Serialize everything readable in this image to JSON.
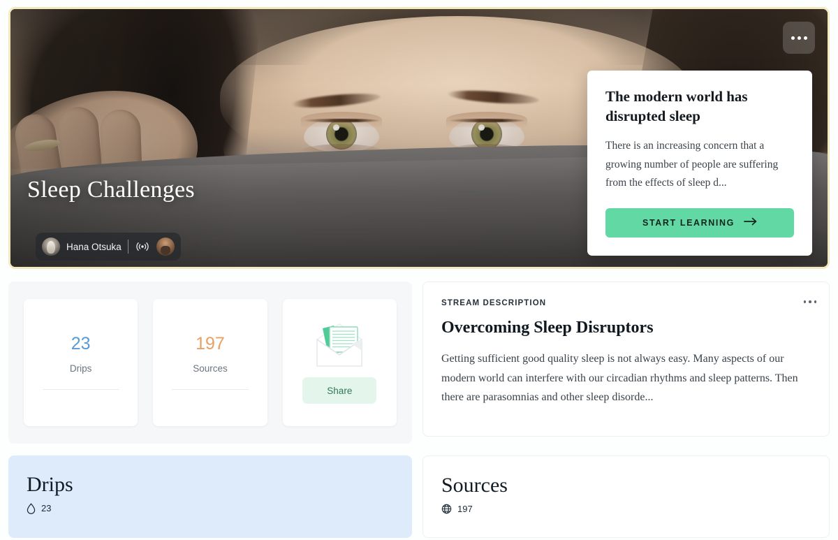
{
  "hero": {
    "title": "Sleep Challenges",
    "author_name": "Hana Otsuka",
    "menu_icon": "overflow-menu-icon",
    "broadcast_icon": "broadcast-icon",
    "card": {
      "heading": "The modern world has disrupted sleep",
      "body": "There is an increasing concern that a growing number of people are suffering from the effects of sleep d...",
      "cta_label": "START LEARNING",
      "cta_icon": "arrow-right-icon",
      "cta_color": "#62d9a4"
    },
    "border_color": "#f3e9bf"
  },
  "stats": {
    "items": [
      {
        "value": "23",
        "label": "Drips",
        "color": "#5b9bd5"
      },
      {
        "value": "197",
        "label": "Sources",
        "color": "#e7a165"
      }
    ],
    "share": {
      "button_label": "Share",
      "illustration_icon": "envelope-documents-icon",
      "button_bg": "#e4f6ec",
      "button_color": "#2f7a52"
    }
  },
  "description": {
    "kicker": "STREAM DESCRIPTION",
    "title": "Overcoming Sleep Disruptors",
    "body": "Getting sufficient good quality sleep is not always easy. Many aspects of our modern world can interfere with our circadian rhythms and sleep patterns. Then there are parasomnias and other sleep disorde...",
    "menu_icon": "overflow-menu-icon"
  },
  "sections": [
    {
      "title": "Drips",
      "count": "23",
      "icon": "droplet-icon",
      "bg": "#ddebfa"
    },
    {
      "title": "Sources",
      "count": "197",
      "icon": "globe-icon",
      "bg": "#ffffff"
    }
  ]
}
